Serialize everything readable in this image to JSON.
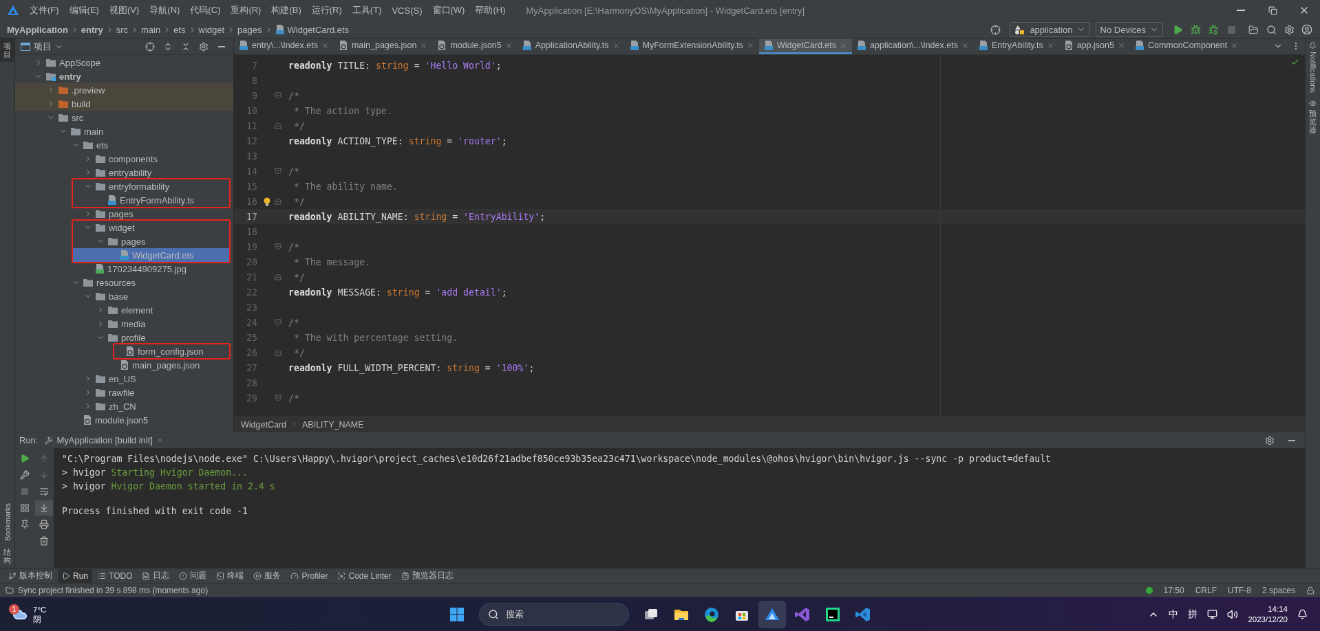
{
  "title_bar": {
    "menus": [
      "文件(F)",
      "编辑(E)",
      "视图(V)",
      "导航(N)",
      "代码(C)",
      "重构(R)",
      "构建(B)",
      "运行(R)",
      "工具(T)",
      "VCS(S)",
      "窗口(W)",
      "帮助(H)"
    ],
    "title": "MyApplication [E:\\HarmonyOS\\MyApplication] - WidgetCard.ets [entry]"
  },
  "nav_bar": {
    "breadcrumb": [
      {
        "label": "MyApplication",
        "kind": "project"
      },
      {
        "label": "entry",
        "kind": "module"
      },
      {
        "label": "src",
        "kind": "dir"
      },
      {
        "label": "main",
        "kind": "dir"
      },
      {
        "label": "ets",
        "kind": "dir"
      },
      {
        "label": "widget",
        "kind": "dir"
      },
      {
        "label": "pages",
        "kind": "dir"
      },
      {
        "label": "WidgetCard.ets",
        "kind": "file"
      }
    ],
    "run_config": "application",
    "device": "No Devices"
  },
  "left_strip": {
    "top": [
      {
        "label": "项目",
        "kind": "stacked",
        "selected": true
      }
    ],
    "bottom": [
      {
        "label": "Bookmarks",
        "kind": "rotated",
        "selected": false
      },
      {
        "label": "结构",
        "kind": "stacked",
        "selected": false
      }
    ]
  },
  "right_strip": [
    {
      "label": "Notifications",
      "kind": "rotated"
    },
    {
      "label": "预览器",
      "kind": "stacked"
    }
  ],
  "project_panel": {
    "title": "项目",
    "tree": [
      {
        "label": "AppScope",
        "kind": "folder",
        "expanded": false,
        "selected": false,
        "marked": false
      },
      {
        "label": "entry",
        "kind": "module",
        "expanded": true,
        "selected": false,
        "marked": false,
        "children": [
          {
            "label": ".preview",
            "kind": "excluded",
            "expanded": false,
            "selected": false,
            "marked": false
          },
          {
            "label": "build",
            "kind": "excluded",
            "expanded": false,
            "selected": false,
            "marked": false
          },
          {
            "label": "src",
            "kind": "folder",
            "expanded": true,
            "selected": false,
            "marked": false,
            "children": [
              {
                "label": "main",
                "kind": "folder",
                "expanded": true,
                "selected": false,
                "marked": false,
                "children": [
                  {
                    "label": "ets",
                    "kind": "folder",
                    "expanded": true,
                    "selected": false,
                    "marked": false,
                    "children": [
                      {
                        "label": "components",
                        "kind": "folder",
                        "expanded": false,
                        "selected": false,
                        "marked": false
                      },
                      {
                        "label": "entryability",
                        "kind": "folder",
                        "expanded": false,
                        "selected": false,
                        "marked": false
                      },
                      {
                        "label": "entryformability",
                        "kind": "folder",
                        "expanded": true,
                        "selected": false,
                        "marked": true,
                        "children": [
                          {
                            "label": "EntryFormAbility.ts",
                            "kind": "ts",
                            "selected": false,
                            "marked": true
                          }
                        ]
                      },
                      {
                        "label": "pages",
                        "kind": "folder",
                        "expanded": false,
                        "selected": false,
                        "marked": false
                      },
                      {
                        "label": "widget",
                        "kind": "folder",
                        "expanded": true,
                        "selected": false,
                        "marked": true,
                        "children": [
                          {
                            "label": "pages",
                            "kind": "folder",
                            "expanded": true,
                            "selected": false,
                            "marked": true,
                            "children": [
                              {
                                "label": "WidgetCard.ets",
                                "kind": "ets",
                                "selected": true,
                                "marked": true
                              }
                            ]
                          }
                        ]
                      },
                      {
                        "label": "1702344909275.jpg",
                        "kind": "image",
                        "selected": false,
                        "marked": false
                      }
                    ]
                  },
                  {
                    "label": "resources",
                    "kind": "folder",
                    "expanded": true,
                    "selected": false,
                    "marked": false,
                    "children": [
                      {
                        "label": "base",
                        "kind": "folder",
                        "expanded": true,
                        "selected": false,
                        "marked": false,
                        "children": [
                          {
                            "label": "element",
                            "kind": "folder",
                            "expanded": false,
                            "selected": false,
                            "marked": false
                          },
                          {
                            "label": "media",
                            "kind": "folder",
                            "expanded": false,
                            "selected": false,
                            "marked": false
                          },
                          {
                            "label": "profile",
                            "kind": "folder",
                            "expanded": true,
                            "selected": false,
                            "marked": false,
                            "children": [
                              {
                                "label": "form_config.json",
                                "kind": "json",
                                "selected": false,
                                "marked": true
                              },
                              {
                                "label": "main_pages.json",
                                "kind": "json",
                                "selected": false,
                                "marked": false
                              }
                            ]
                          }
                        ]
                      },
                      {
                        "label": "en_US",
                        "kind": "folder",
                        "expanded": false,
                        "selected": false,
                        "marked": false
                      },
                      {
                        "label": "rawfile",
                        "kind": "folder",
                        "expanded": false,
                        "selected": false,
                        "marked": false
                      },
                      {
                        "label": "zh_CN",
                        "kind": "folder",
                        "expanded": false,
                        "selected": false,
                        "marked": false
                      }
                    ]
                  },
                  {
                    "label": "module.json5",
                    "kind": "json",
                    "selected": false,
                    "marked": false
                  }
                ]
              }
            ]
          }
        ]
      }
    ]
  },
  "editor": {
    "tabs": [
      {
        "label": "entry\\...\\Index.ets",
        "kind": "ets",
        "selected": false
      },
      {
        "label": "main_pages.json",
        "kind": "json",
        "selected": false
      },
      {
        "label": "module.json5",
        "kind": "json",
        "selected": false
      },
      {
        "label": "ApplicationAbility.ts",
        "kind": "ts",
        "selected": false
      },
      {
        "label": "MyFormExtensionAbility.ts",
        "kind": "ts",
        "selected": false
      },
      {
        "label": "WidgetCard.ets",
        "kind": "ets",
        "selected": true
      },
      {
        "label": "application\\...\\Index.ets",
        "kind": "ets",
        "selected": false
      },
      {
        "label": "EntryAbility.ts",
        "kind": "ts",
        "selected": false
      },
      {
        "label": "app.json5",
        "kind": "json",
        "selected": false
      },
      {
        "label": "CommonComponent",
        "kind": "ets",
        "selected": false
      }
    ],
    "lines": [
      {
        "number": "7",
        "kind": "plain",
        "current": false,
        "bulb": false,
        "tokens": [
          {
            "kind": "keyword",
            "text": "readonly"
          },
          {
            "kind": "plain",
            "text": " TITLE: "
          },
          {
            "kind": "type",
            "text": "string"
          },
          {
            "kind": "plain",
            "text": " = "
          },
          {
            "kind": "string",
            "text": "'Hello World'"
          },
          {
            "kind": "plain",
            "text": ";"
          }
        ]
      },
      {
        "number": "8",
        "kind": "plain",
        "current": false,
        "bulb": false
      },
      {
        "number": "9",
        "kind": "fold_start",
        "current": false,
        "bulb": false,
        "tokens": [
          {
            "kind": "comment",
            "text": "/*"
          }
        ]
      },
      {
        "number": "10",
        "kind": "plain",
        "current": false,
        "bulb": false,
        "tokens": [
          {
            "kind": "comment",
            "text": " * The action type."
          }
        ]
      },
      {
        "number": "11",
        "kind": "fold_end",
        "current": false,
        "bulb": false,
        "tokens": [
          {
            "kind": "comment",
            "text": " */"
          }
        ]
      },
      {
        "number": "12",
        "kind": "plain",
        "current": false,
        "bulb": false,
        "tokens": [
          {
            "kind": "keyword",
            "text": "readonly"
          },
          {
            "kind": "plain",
            "text": " ACTION_TYPE: "
          },
          {
            "kind": "type",
            "text": "string"
          },
          {
            "kind": "plain",
            "text": " = "
          },
          {
            "kind": "string",
            "text": "'router'"
          },
          {
            "kind": "plain",
            "text": ";"
          }
        ]
      },
      {
        "number": "13",
        "kind": "plain",
        "current": false,
        "bulb": false
      },
      {
        "number": "14",
        "kind": "fold_start",
        "current": false,
        "bulb": false,
        "tokens": [
          {
            "kind": "comment",
            "text": "/*"
          }
        ]
      },
      {
        "number": "15",
        "kind": "plain",
        "current": false,
        "bulb": false,
        "tokens": [
          {
            "kind": "comment",
            "text": " * The ability name."
          }
        ]
      },
      {
        "number": "16",
        "kind": "fold_end",
        "current": false,
        "bulb": true,
        "tokens": [
          {
            "kind": "comment",
            "text": " */"
          }
        ]
      },
      {
        "number": "17",
        "kind": "plain",
        "current": true,
        "bulb": false,
        "tokens": [
          {
            "kind": "keyword",
            "text": "readonly"
          },
          {
            "kind": "plain",
            "text": " ABILITY_NAME: "
          },
          {
            "kind": "type",
            "text": "string"
          },
          {
            "kind": "plain",
            "text": " = "
          },
          {
            "kind": "string",
            "text": "'EntryAbility'"
          },
          {
            "kind": "plain",
            "text": ";"
          }
        ]
      },
      {
        "number": "18",
        "kind": "plain",
        "current": false,
        "bulb": false
      },
      {
        "number": "19",
        "kind": "fold_start",
        "current": false,
        "bulb": false,
        "tokens": [
          {
            "kind": "comment",
            "text": "/*"
          }
        ]
      },
      {
        "number": "20",
        "kind": "plain",
        "current": false,
        "bulb": false,
        "tokens": [
          {
            "kind": "comment",
            "text": " * The message."
          }
        ]
      },
      {
        "number": "21",
        "kind": "fold_end",
        "current": false,
        "bulb": false,
        "tokens": [
          {
            "kind": "comment",
            "text": " */"
          }
        ]
      },
      {
        "number": "22",
        "kind": "plain",
        "current": false,
        "bulb": false,
        "tokens": [
          {
            "kind": "keyword",
            "text": "readonly"
          },
          {
            "kind": "plain",
            "text": " MESSAGE: "
          },
          {
            "kind": "type",
            "text": "string"
          },
          {
            "kind": "plain",
            "text": " = "
          },
          {
            "kind": "string",
            "text": "'add detail'"
          },
          {
            "kind": "plain",
            "text": ";"
          }
        ]
      },
      {
        "number": "23",
        "kind": "plain",
        "current": false,
        "bulb": false
      },
      {
        "number": "24",
        "kind": "fold_start",
        "current": false,
        "bulb": false,
        "tokens": [
          {
            "kind": "comment",
            "text": "/*"
          }
        ]
      },
      {
        "number": "25",
        "kind": "plain",
        "current": false,
        "bulb": false,
        "tokens": [
          {
            "kind": "comment",
            "text": " * The with percentage setting."
          }
        ]
      },
      {
        "number": "26",
        "kind": "fold_end",
        "current": false,
        "bulb": false,
        "tokens": [
          {
            "kind": "comment",
            "text": " */"
          }
        ]
      },
      {
        "number": "27",
        "kind": "plain",
        "current": false,
        "bulb": false,
        "tokens": [
          {
            "kind": "keyword",
            "text": "readonly"
          },
          {
            "kind": "plain",
            "text": " FULL_WIDTH_PERCENT: "
          },
          {
            "kind": "type",
            "text": "string"
          },
          {
            "kind": "plain",
            "text": " = "
          },
          {
            "kind": "string",
            "text": "'100%'"
          },
          {
            "kind": "plain",
            "text": ";"
          }
        ]
      },
      {
        "number": "28",
        "kind": "plain",
        "current": false,
        "bulb": false
      },
      {
        "number": "29",
        "kind": "fold_start",
        "current": false,
        "bulb": false,
        "tokens": [
          {
            "kind": "comment",
            "text": "/*"
          }
        ]
      }
    ],
    "breadcrumb": [
      "WidgetCard",
      "ABILITY_NAME"
    ]
  },
  "run_panel": {
    "label": "Run:",
    "tab": "MyApplication [build init]",
    "lines": [
      {
        "kind": "command",
        "text": "\"C:\\Program Files\\nodejs\\node.exe\" C:\\Users\\Happy\\.hvigor\\project_caches\\e10d26f21adbef850ce93b35ea23c471\\workspace\\node_modules\\@ohos\\hvigor\\bin\\hvigor.js --sync -p product=default"
      },
      {
        "kind": "log",
        "prefix": "> hvigor",
        "text": "Starting Hvigor Daemon..."
      },
      {
        "kind": "log",
        "prefix": "> hvigor",
        "text": "Hvigor Daemon started in 2.4 s"
      },
      {
        "kind": "exit",
        "text": "Process finished with exit code -1"
      }
    ]
  },
  "tool_tabs": [
    {
      "label": "版本控制",
      "kind": "vcs",
      "selected": false
    },
    {
      "label": "Run",
      "kind": "run",
      "selected": true
    },
    {
      "label": "TODO",
      "kind": "todo",
      "selected": false
    },
    {
      "label": "日志",
      "kind": "log",
      "selected": false
    },
    {
      "label": "问题",
      "kind": "problems",
      "selected": false
    },
    {
      "label": "终端",
      "kind": "terminal",
      "selected": false
    },
    {
      "label": "服务",
      "kind": "services",
      "selected": false
    },
    {
      "label": "Profiler",
      "kind": "profiler",
      "selected": false
    },
    {
      "label": "Code Linter",
      "kind": "linter",
      "selected": false
    },
    {
      "label": "预览器日志",
      "kind": "previewlog",
      "selected": false
    }
  ],
  "status_bar": {
    "message": "Sync project finished in 39 s 898 ms (moments ago)",
    "items": [
      "17:50",
      "CRLF",
      "UTF-8",
      "2 spaces"
    ]
  },
  "taskbar": {
    "weather": {
      "badge": "1",
      "temperature": "7°C",
      "condition": "阴"
    },
    "search": "搜索",
    "apps": [
      {
        "kind": "taskview",
        "selected": false
      },
      {
        "kind": "explorer",
        "selected": false
      },
      {
        "kind": "edge",
        "selected": false
      },
      {
        "kind": "store",
        "selected": false
      },
      {
        "kind": "deveco",
        "selected": true
      },
      {
        "kind": "vs",
        "selected": false
      },
      {
        "kind": "pycharm",
        "selected": false
      },
      {
        "kind": "vscode",
        "selected": false
      }
    ],
    "ime": [
      "中",
      "拼"
    ],
    "time": "14:14",
    "date": "2023/12/20"
  }
}
